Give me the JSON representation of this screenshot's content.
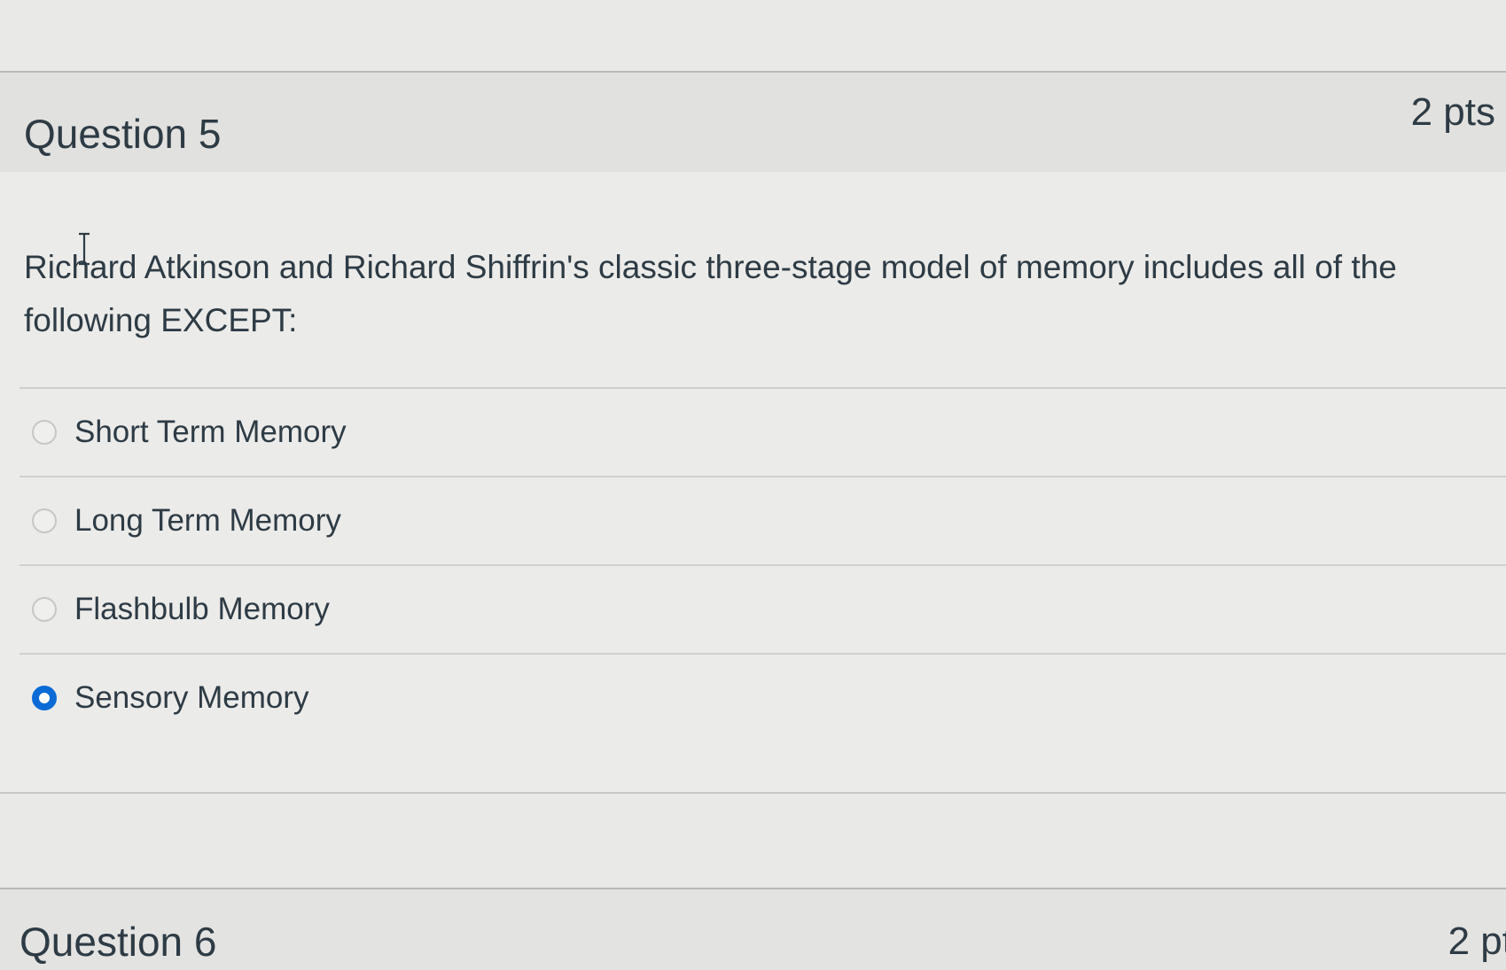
{
  "question5": {
    "title": "Question 5",
    "points": "2 pts",
    "text": "Richard Atkinson and Richard Shiffrin's classic three-stage model of memory includes all of the following EXCEPT:",
    "answers": [
      {
        "label": "Short Term Memory",
        "selected": false
      },
      {
        "label": "Long Term Memory",
        "selected": false
      },
      {
        "label": "Flashbulb Memory",
        "selected": false
      },
      {
        "label": "Sensory Memory",
        "selected": true
      }
    ]
  },
  "question6": {
    "title": "Question 6",
    "points": "2 pt"
  },
  "colors": {
    "selected_radio": "#0b6bd6",
    "text": "#2d3b45",
    "background": "#e9e9e7"
  },
  "icons": {
    "cursor": "text-cursor-icon"
  }
}
